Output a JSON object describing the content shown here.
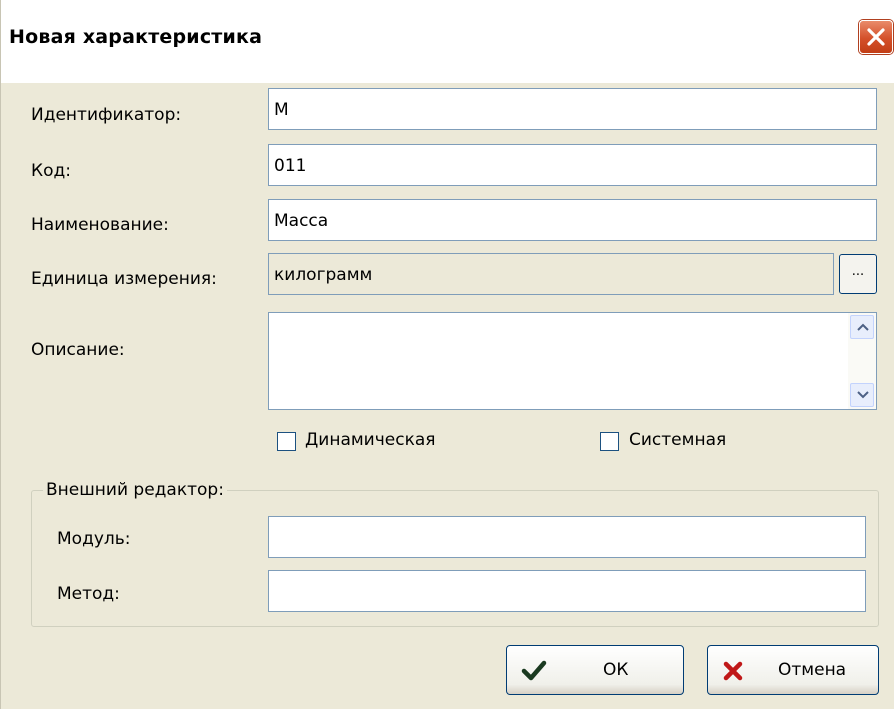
{
  "window": {
    "title": "Новая характеристика"
  },
  "fields": {
    "identifier": {
      "label": "Идентификатор:",
      "value": "М"
    },
    "code": {
      "label": "Код:",
      "value": "011"
    },
    "name": {
      "label": "Наименование:",
      "value": "Масса"
    },
    "unit": {
      "label": "Единица измерения:",
      "value": "килограмм",
      "browse_label": "..."
    },
    "description": {
      "label": "Описание:",
      "value": ""
    }
  },
  "checkboxes": {
    "dynamic": {
      "label": "Динамическая",
      "checked": false
    },
    "system": {
      "label": "Системная",
      "checked": false
    }
  },
  "external_editor": {
    "title": "Внешний редактор:",
    "module": {
      "label": "Модуль:",
      "value": ""
    },
    "method": {
      "label": "Метод:",
      "value": ""
    }
  },
  "buttons": {
    "ok": {
      "label": "ОК",
      "icon": "checkmark-icon",
      "icon_color": "#1a3a20"
    },
    "cancel": {
      "label": "Отмена",
      "icon": "cross-icon",
      "icon_color": "#c01818"
    }
  },
  "icons": {
    "close": "close-icon",
    "scroll_up": "scroll-up-icon",
    "scroll_down": "scroll-down-icon"
  }
}
